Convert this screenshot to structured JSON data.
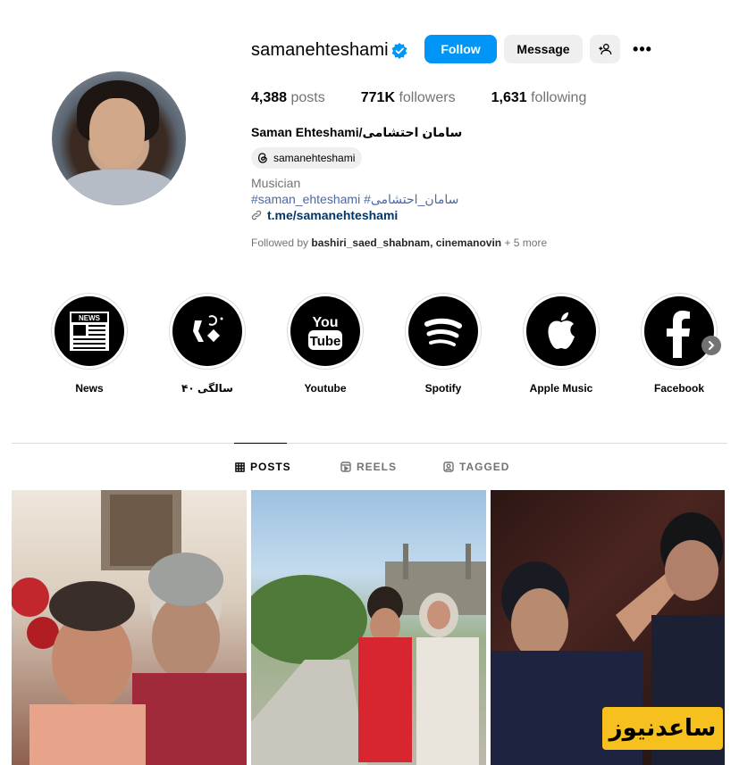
{
  "profile": {
    "username": "samanehteshami",
    "full_name": "Saman Ehteshami/سامان احتشامی",
    "threads_handle": "samanehteshami",
    "category": "Musician",
    "hashtags": "#saman_ehteshami #سامان_احتشامی",
    "link": "t.me/samanehteshami",
    "followed_by_prefix": "Followed by ",
    "followed_by_names": "bashiri_saed_shabnam, cinemanovin",
    "followed_by_more": " + 5 more"
  },
  "actions": {
    "follow_label": "Follow",
    "message_label": "Message",
    "more_label": "•••"
  },
  "stats": {
    "posts_count": "4,388",
    "posts_label": "posts",
    "followers_count": "771K",
    "followers_label": "followers",
    "following_count": "1,631",
    "following_label": "following"
  },
  "highlights": [
    {
      "label": "News",
      "icon": "news-icon"
    },
    {
      "label": "۴۰ سالگی",
      "icon": "forty-years-icon"
    },
    {
      "label": "Youtube",
      "icon": "youtube-icon"
    },
    {
      "label": "Spotify",
      "icon": "spotify-icon"
    },
    {
      "label": "Apple Music",
      "icon": "apple-icon"
    },
    {
      "label": "Facebook",
      "icon": "facebook-icon"
    }
  ],
  "tabs": [
    {
      "label": "POSTS",
      "active": true
    },
    {
      "label": "REELS",
      "active": false
    },
    {
      "label": "TAGGED",
      "active": false
    }
  ],
  "watermark": "ساعدنیوز",
  "colors": {
    "accent": "#0095f6",
    "link": "#00376b",
    "hashtag": "#4c68a6",
    "secondary_text": "#737373",
    "watermark_bg": "#f6c11f"
  }
}
